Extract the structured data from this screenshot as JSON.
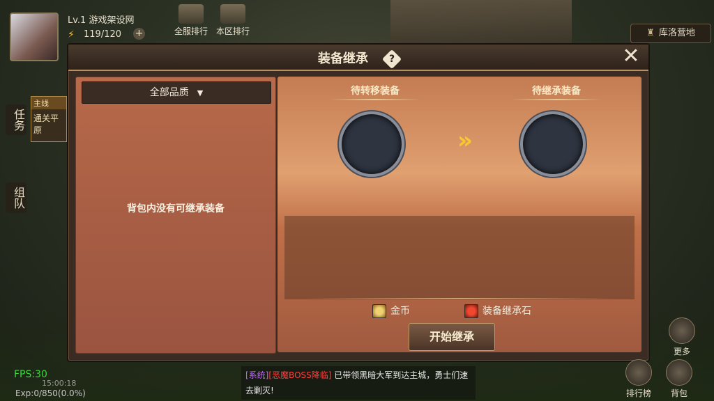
{
  "hud": {
    "level": "Lv.1",
    "server_name": "游戏架设网",
    "energy": "119/120",
    "plus": "+"
  },
  "top_icons": [
    {
      "label": "全服排行"
    },
    {
      "label": "本区排行"
    }
  ],
  "location_button": "库洛营地",
  "side_tabs": {
    "task": "任务",
    "team": "组队",
    "mainline_tag": "主线",
    "mainline_desc": "通关平原"
  },
  "dialog": {
    "title": "装备继承",
    "help": "?",
    "close": "✕",
    "quality_filter": "全部品质",
    "dropdown_arrow": "▼",
    "empty_message": "背包内没有可继承装备",
    "source_slot_label": "待转移装备",
    "target_slot_label": "待继承装备",
    "arrow_glyph": "»",
    "costs": [
      {
        "name": "金币",
        "icon": "coin-icon"
      },
      {
        "name": "装备继承石",
        "icon": "inherit-stone-icon"
      }
    ],
    "start_button": "开始继承"
  },
  "bottom": {
    "fps": "FPS:30",
    "time": "15:00:18",
    "exp": "Exp:0/850(0.0%)",
    "chat_system": "[系统]",
    "chat_boss": "[恶魔BOSS降临]",
    "chat_text": "已带领黑暗大军到达主城，勇士们速去剿灭!"
  },
  "right_buttons": [
    {
      "label": "更多"
    },
    {
      "label": "排行榜"
    },
    {
      "label": "背包"
    }
  ]
}
